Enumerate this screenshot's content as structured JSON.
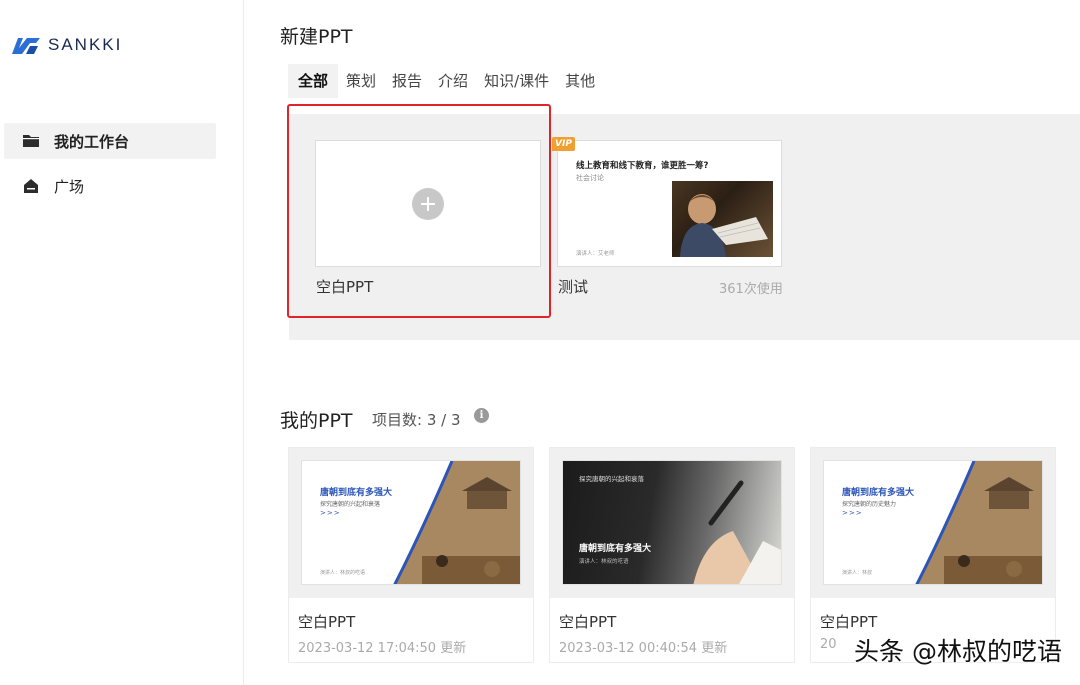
{
  "brand": {
    "name": "SANKKI",
    "color": "#2b6fd6"
  },
  "sidebar": {
    "items": [
      {
        "label": "我的工作台",
        "icon": "folder-icon",
        "active": true
      },
      {
        "label": "广场",
        "icon": "home-icon",
        "active": false
      }
    ]
  },
  "new_ppt": {
    "title": "新建PPT",
    "tabs": [
      "全部",
      "策划",
      "报告",
      "介绍",
      "知识/课件",
      "其他"
    ],
    "active_tab": "全部",
    "blank_card": {
      "label": "空白PPT",
      "icon": "plus-icon"
    },
    "template_card": {
      "badge": "VIP",
      "label": "测试",
      "usage": "361次使用",
      "slide_title": "线上教育和线下教育，谁更胜一筹?",
      "slide_subtitle": "社会讨论",
      "slide_author": "演讲人：艾老师"
    }
  },
  "my_ppt": {
    "title": "我的PPT",
    "count_label": "项目数: 3 / 3",
    "projects": [
      {
        "name": "空白PPT",
        "updated": "2023-03-12 17:04:50 更新",
        "slide_title": "唐朝到底有多强大",
        "slide_subtitle": "探究唐朝的兴起和衰落",
        "slide_arrows": ">>>",
        "slide_author": "演讲人：林叔的呓语"
      },
      {
        "name": "空白PPT",
        "updated": "2023-03-12 00:40:54 更新",
        "slide_top": "探究唐朝的兴起和衰落",
        "slide_title": "唐朝到底有多强大",
        "slide_subtitle": "演讲人：林叔的呓语"
      },
      {
        "name": "空白PPT",
        "updated": "20",
        "slide_title": "唐朝到底有多强大",
        "slide_subtitle": "探究唐朝的历史魅力",
        "slide_arrows": ">>>",
        "slide_author": "演讲人：林叔"
      }
    ]
  },
  "watermark": "头条 @林叔的呓语",
  "colors": {
    "highlight": "#e0242a",
    "vip": "#f0a030",
    "slide_accent": "#2b55b8"
  }
}
